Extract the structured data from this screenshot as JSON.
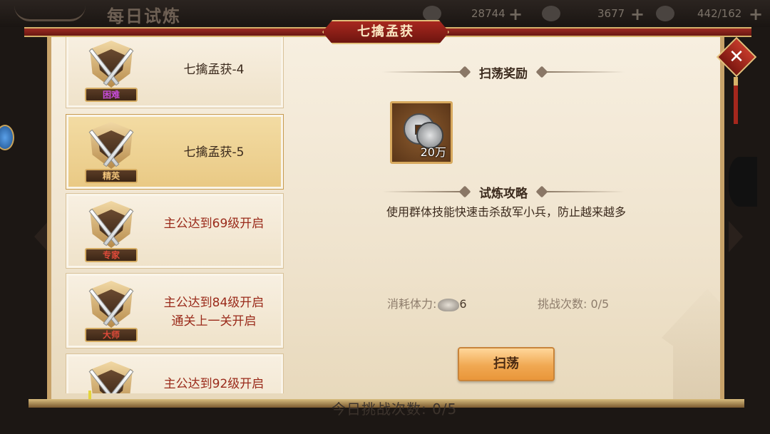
{
  "topbar": {
    "title": "每日试炼",
    "resources": [
      {
        "icon": "coin-icon",
        "value": "28744"
      },
      {
        "icon": "ingot-icon",
        "value": "3677"
      },
      {
        "icon": "stamina-stone-icon",
        "value": "442/162"
      }
    ],
    "plus": "+"
  },
  "panel": {
    "title": "七擒孟获",
    "close": "✕"
  },
  "list": [
    {
      "tag": "困难",
      "tag_color": "#c54bd9",
      "name": "七擒孟获-4",
      "req1": "",
      "req2": "",
      "selected": false
    },
    {
      "tag": "精英",
      "tag_color": "#f0c27a",
      "name": "七擒孟获-5",
      "req1": "",
      "req2": "",
      "selected": true
    },
    {
      "tag": "专家",
      "tag_color": "#e04a3a",
      "name": "",
      "req1": "主公达到69级开启",
      "req2": "",
      "selected": false
    },
    {
      "tag": "大师",
      "tag_color": "#e04a3a",
      "name": "",
      "req1": "主公达到84级开启",
      "req2": "通关上一关开启",
      "selected": false
    },
    {
      "tag": "",
      "tag_color": "#e04a3a",
      "name": "",
      "req1": "主公达到92级开启",
      "req2": "",
      "selected": false
    }
  ],
  "detail": {
    "reward_title": "扫荡奖励",
    "reward_amount": "20万",
    "strategy_title": "试炼攻略",
    "strategy_text": "使用群体技能快速击杀敌军小兵，防止越来越多",
    "cost_label": "消耗体力:",
    "cost_value": "6",
    "tries_label": "挑战次数: 0/5",
    "sweep_button": "扫荡"
  },
  "bottom_ghost": "今日挑战次数: 0/5"
}
